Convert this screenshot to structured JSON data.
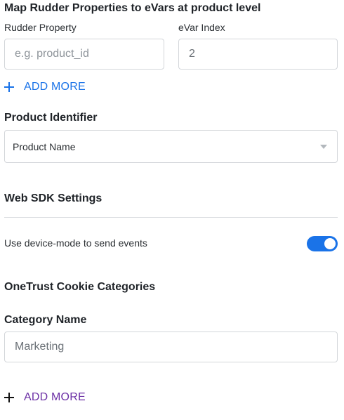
{
  "evar_mapping": {
    "title": "Map Rudder Properties to eVars at product level",
    "property_label": "Rudder Property",
    "index_label": "eVar Index",
    "property_placeholder": "e.g. product_id",
    "index_value": "2",
    "add_more_label": "ADD MORE",
    "add_more_color": "#1a73e8"
  },
  "product_identifier": {
    "title": "Product Identifier",
    "selected": "Product Name"
  },
  "web_sdk": {
    "title": "Web SDK Settings",
    "device_mode_label": "Use device-mode to send events",
    "device_mode_enabled": true,
    "toggle_color": "#1a73e8"
  },
  "onetrust": {
    "title": "OneTrust Cookie Categories",
    "category_label": "Category Name",
    "category_value": "Marketing",
    "add_more_label": "ADD MORE",
    "add_more_color": "#6b2fa5"
  }
}
